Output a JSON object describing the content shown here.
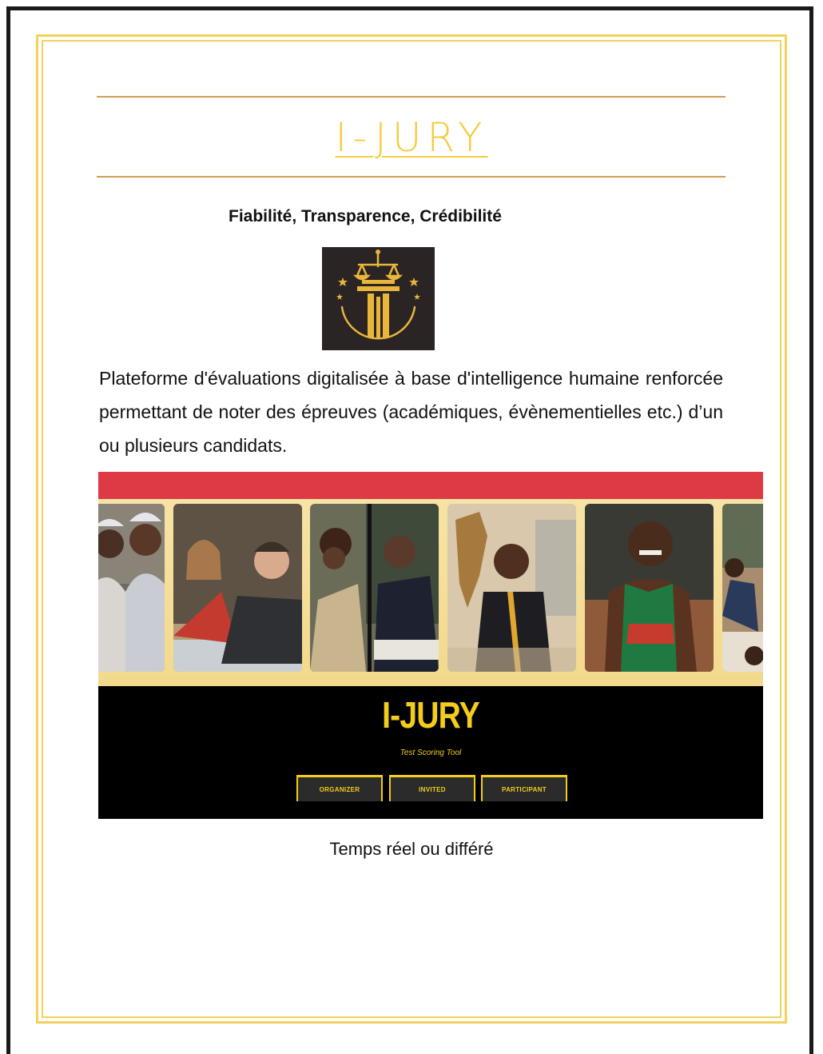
{
  "document": {
    "title": "I-JURY",
    "tagline": "Fiabilité, Transparence, Crédibilité",
    "description": "Plateforme d'évaluations digitalisée à base d'intelligence humaine renforcée permettant de noter des épreuves (académiques, évènementielles etc.) d’un ou plusieurs candidats.",
    "caption": "Temps réel ou  différé"
  },
  "banner": {
    "logo_text": "I-JURY",
    "subtitle": "Test Scoring Tool",
    "buttons": [
      "ORGANIZER",
      "INVITED",
      "PARTICIPANT"
    ],
    "photos": [
      "pageant-winners-photo",
      "jury-panel-photo",
      "students-and-judges-photo",
      "candidate-in-suit-photo",
      "athlete-photo",
      "exam-room-photo"
    ]
  },
  "colors": {
    "gold": "#f4cd3e",
    "frame_gold": "#f3d25b",
    "rule": "#d49b55",
    "banner_red": "#dd3a45",
    "banner_black": "#000000",
    "logo_tile": "#2a2524"
  }
}
